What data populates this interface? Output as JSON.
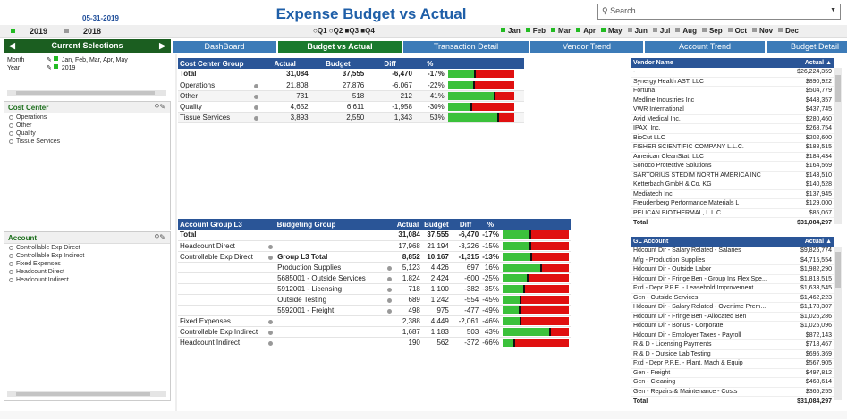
{
  "header": {
    "date": "05-31-2019",
    "title": "Expense Budget vs Actual",
    "search_placeholder": "Search"
  },
  "years": [
    {
      "label": "2019",
      "selected": true
    },
    {
      "label": "2018",
      "selected": false
    }
  ],
  "quarters": [
    "Q1",
    "Q2",
    "Q3",
    "Q4"
  ],
  "months": [
    {
      "label": "Jan",
      "selected": true
    },
    {
      "label": "Feb",
      "selected": true
    },
    {
      "label": "Mar",
      "selected": true
    },
    {
      "label": "Apr",
      "selected": true
    },
    {
      "label": "May",
      "selected": true
    },
    {
      "label": "Jun",
      "selected": false
    },
    {
      "label": "Jul",
      "selected": false
    },
    {
      "label": "Aug",
      "selected": false
    },
    {
      "label": "Sep",
      "selected": false
    },
    {
      "label": "Oct",
      "selected": false
    },
    {
      "label": "Nov",
      "selected": false
    },
    {
      "label": "Dec",
      "selected": false
    }
  ],
  "current_selections": {
    "title": "Current Selections",
    "rows": [
      {
        "field": "Month",
        "value": "Jan, Feb, Mar, Apr, May"
      },
      {
        "field": "Year",
        "value": "2019"
      }
    ]
  },
  "cost_center_panel": {
    "title": "Cost Center",
    "items": [
      "Operations",
      "Other",
      "Quality",
      "Tissue Services"
    ]
  },
  "account_panel": {
    "title": "Account",
    "items": [
      "Controllable Exp Direct",
      "Controllable Exp Indirect",
      "Fixed Expenses",
      "Headcount Direct",
      "Headcount Indirect"
    ]
  },
  "tabs": [
    "DashBoard",
    "Budget vs Actual",
    "Transaction Detail",
    "Vendor Trend",
    "Account Trend",
    "Budget Detail"
  ],
  "active_tab": "Budget vs Actual",
  "colors": {
    "accent_green": "#1a7a2e",
    "tab_blue": "#3c7bb8",
    "header_blue": "#2a5597",
    "bar_red": "#e01010",
    "bar_green": "#3bc13b"
  },
  "cost_center_table": {
    "headers": [
      "Cost Center Group",
      "Actual",
      "Budget",
      "Diff",
      "%"
    ],
    "total": {
      "name": "Total",
      "actual": "31,084",
      "budget": "37,555",
      "diff": "-6,470",
      "pct": "-17%",
      "pct_value": -17
    },
    "rows": [
      {
        "name": "Operations",
        "actual": "21,808",
        "budget": "27,876",
        "diff": "-6,067",
        "pct": "-22%",
        "pct_value": -22
      },
      {
        "name": "Other",
        "actual": "731",
        "budget": "518",
        "diff": "212",
        "pct": "41%",
        "pct_value": 41
      },
      {
        "name": "Quality",
        "actual": "4,652",
        "budget": "6,611",
        "diff": "-1,958",
        "pct": "-30%",
        "pct_value": -30
      },
      {
        "name": "Tissue Services",
        "actual": "3,893",
        "budget": "2,550",
        "diff": "1,343",
        "pct": "53%",
        "pct_value": 53
      }
    ]
  },
  "account_table": {
    "headers": [
      "Account Group L3",
      "Budgeting Group",
      "Actual",
      "Budget",
      "Diff",
      "%"
    ],
    "total": {
      "group": "Total",
      "actual": "31,084",
      "budget": "37,555",
      "diff": "-6,470",
      "pct": "-17%",
      "pct_value": -17
    },
    "rows": [
      {
        "group": "Headcount Direct",
        "sub": "",
        "actual": "17,968",
        "budget": "21,194",
        "diff": "-3,226",
        "pct": "-15%",
        "pct_value": -15
      },
      {
        "group": "Controllable Exp Direct",
        "sub": "Group L3 Total",
        "actual": "8,852",
        "budget": "10,167",
        "diff": "-1,315",
        "pct": "-13%",
        "pct_value": -13,
        "bold": true
      },
      {
        "group": "",
        "sub": "Production Supplies",
        "actual": "5,123",
        "budget": "4,426",
        "diff": "697",
        "pct": "16%",
        "pct_value": 16
      },
      {
        "group": "",
        "sub": "5685001 - Outside Services",
        "actual": "1,824",
        "budget": "2,424",
        "diff": "-600",
        "pct": "-25%",
        "pct_value": -25
      },
      {
        "group": "",
        "sub": "5912001 - Licensing",
        "actual": "718",
        "budget": "1,100",
        "diff": "-382",
        "pct": "-35%",
        "pct_value": -35
      },
      {
        "group": "",
        "sub": "Outside Testing",
        "actual": "689",
        "budget": "1,242",
        "diff": "-554",
        "pct": "-45%",
        "pct_value": -45
      },
      {
        "group": "",
        "sub": "5592001 - Freight",
        "actual": "498",
        "budget": "975",
        "diff": "-477",
        "pct": "-49%",
        "pct_value": -49
      },
      {
        "group": "Fixed Expenses",
        "sub": "",
        "actual": "2,388",
        "budget": "4,449",
        "diff": "-2,061",
        "pct": "-46%",
        "pct_value": -46
      },
      {
        "group": "Controllable Exp Indirect",
        "sub": "",
        "actual": "1,687",
        "budget": "1,183",
        "diff": "503",
        "pct": "43%",
        "pct_value": 43
      },
      {
        "group": "Headcount Indirect",
        "sub": "",
        "actual": "190",
        "budget": "562",
        "diff": "-372",
        "pct": "-66%",
        "pct_value": -66
      }
    ]
  },
  "vendor_table": {
    "headers": [
      "Vendor Name",
      "Actual"
    ],
    "rows": [
      {
        "name": "-",
        "actual": "$26,224,359"
      },
      {
        "name": "Synergy Health AST, LLC",
        "actual": "$890,922"
      },
      {
        "name": "Fortuna",
        "actual": "$504,779"
      },
      {
        "name": "Medline Industries Inc",
        "actual": "$443,357"
      },
      {
        "name": "VWR International",
        "actual": "$437,745"
      },
      {
        "name": "Avid Medical Inc.",
        "actual": "$280,460"
      },
      {
        "name": "IPAX, Inc.",
        "actual": "$268,754"
      },
      {
        "name": "BioCut LLC",
        "actual": "$202,600"
      },
      {
        "name": "FISHER SCIENTIFIC COMPANY L.L.C.",
        "actual": "$188,515"
      },
      {
        "name": "American CleanStat, LLC",
        "actual": "$184,434"
      },
      {
        "name": "Sonoco Protective Solutions",
        "actual": "$164,569"
      },
      {
        "name": "SARTORIUS STEDIM NORTH AMERICA INC",
        "actual": "$143,510"
      },
      {
        "name": "Ketterbach GmbH & Co. KG",
        "actual": "$140,528"
      },
      {
        "name": "Mediatech Inc",
        "actual": "$137,945"
      },
      {
        "name": "Freudenberg Performance Materials L",
        "actual": "$129,000"
      },
      {
        "name": "PELICAN BIOTHERMAL, L.L.C.",
        "actual": "$85,067"
      }
    ],
    "total": {
      "name": "Total",
      "actual": "$31,084,297"
    }
  },
  "gl_table": {
    "headers": [
      "GL Account",
      "Actual"
    ],
    "rows": [
      {
        "name": "Hdcount Dir - Salary Related - Salaries",
        "actual": "$9,826,774"
      },
      {
        "name": "Mfg - Production Supplies",
        "actual": "$4,715,554"
      },
      {
        "name": "Hdcount Dir - Outside Labor",
        "actual": "$1,982,290"
      },
      {
        "name": "Hdcount Dir - Fringe Ben - Group Ins Flex Spe...",
        "actual": "$1,813,515"
      },
      {
        "name": "Fxd - Depr P.P.E. - Leasehold Improvement",
        "actual": "$1,633,545"
      },
      {
        "name": "Gen - Outside Services",
        "actual": "$1,462,223"
      },
      {
        "name": "Hdcount Dir - Salary Related - Overtime Prem...",
        "actual": "$1,178,307"
      },
      {
        "name": "Hdcount Dir - Fringe Ben - Allocated Ben",
        "actual": "$1,026,286"
      },
      {
        "name": "Hdcount Dir - Bonus - Corporate",
        "actual": "$1,025,096"
      },
      {
        "name": "Hdcount Dir - Employer Taxes - Payroll",
        "actual": "$872,143"
      },
      {
        "name": "R & D - Licensing Payments",
        "actual": "$718,467"
      },
      {
        "name": "R & D - Outside Lab Testing",
        "actual": "$695,369"
      },
      {
        "name": "Fxd - Depr P.P.E. - Plant, Mach & Equip",
        "actual": "$567,905"
      },
      {
        "name": "Gen - Freight",
        "actual": "$497,812"
      },
      {
        "name": "Gen - Cleaning",
        "actual": "$468,614"
      },
      {
        "name": "Gen - Repairs & Maintenance - Costs",
        "actual": "$365,255"
      }
    ],
    "total": {
      "name": "Total",
      "actual": "$31,084,297"
    }
  }
}
